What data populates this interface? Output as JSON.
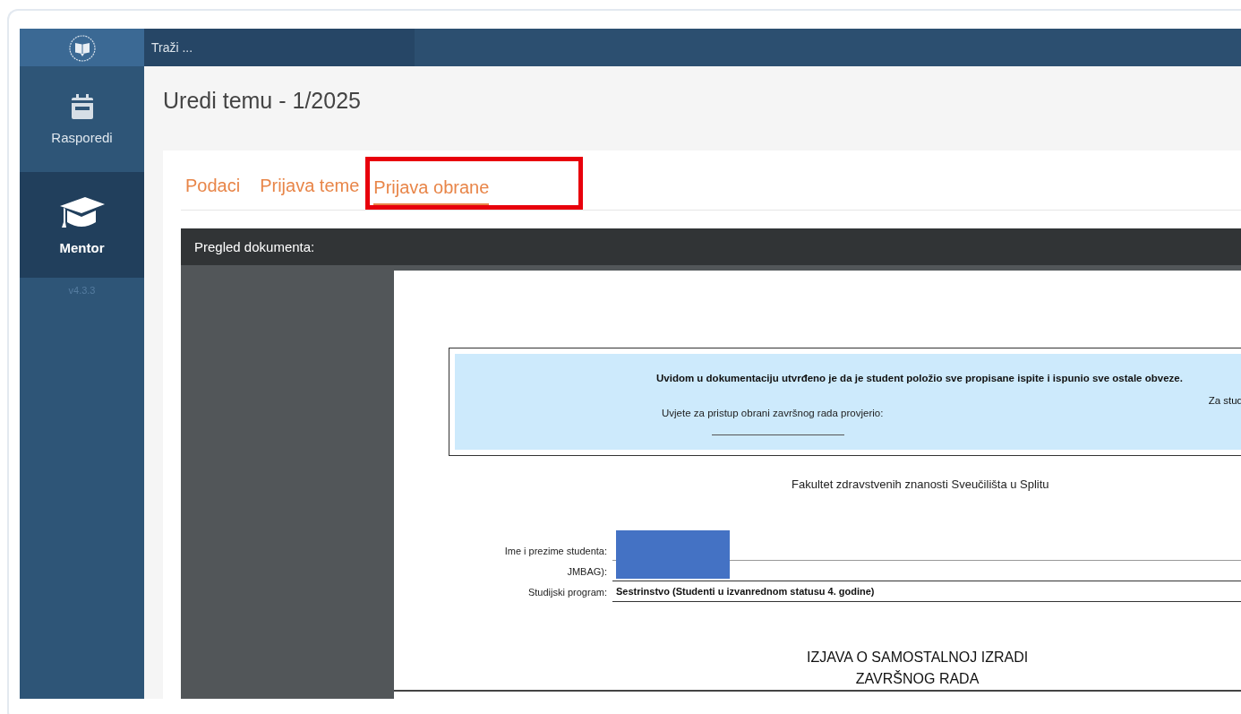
{
  "sidebar": {
    "items": [
      {
        "label": "Rasporedi",
        "selected": false
      },
      {
        "label": "Mentor",
        "selected": true
      }
    ],
    "version": "v4.3.3"
  },
  "search": {
    "placeholder": "Traži ..."
  },
  "page": {
    "title": "Uredi temu - 1/2025"
  },
  "tabs": [
    {
      "label": "Podaci",
      "selected": false,
      "highlighted": false
    },
    {
      "label": "Prijava teme",
      "selected": false,
      "highlighted": false
    },
    {
      "label": "Prijava obrane",
      "selected": true,
      "highlighted": true
    }
  ],
  "document_viewer": {
    "title": "Pregled dokumenta:",
    "notice": {
      "statement": "Uvidom u dokumentaciju utvrđeno je da je student položio sve propisane ispite i ispunio sve ostale obveze.",
      "right_text": "Za stud",
      "check_label": "Uvjete za pristup obrani završnog rada provjerio:"
    },
    "institution": "Fakultet zdravstvenih znanosti Sveučilišta u Splitu",
    "fields": [
      {
        "label": "Ime i prezime studenta:",
        "redacted": true
      },
      {
        "label": "JMBAG):",
        "redacted": false
      },
      {
        "label": "Studijski program:",
        "value": "Sestrinstvo (Studenti u izvanrednom statusu 4. godine)",
        "redacted": false
      }
    ],
    "heading": [
      "IZJAVA O SAMOSTALNOJ IZRADI",
      "ZAVRŠNOG RADA"
    ]
  }
}
